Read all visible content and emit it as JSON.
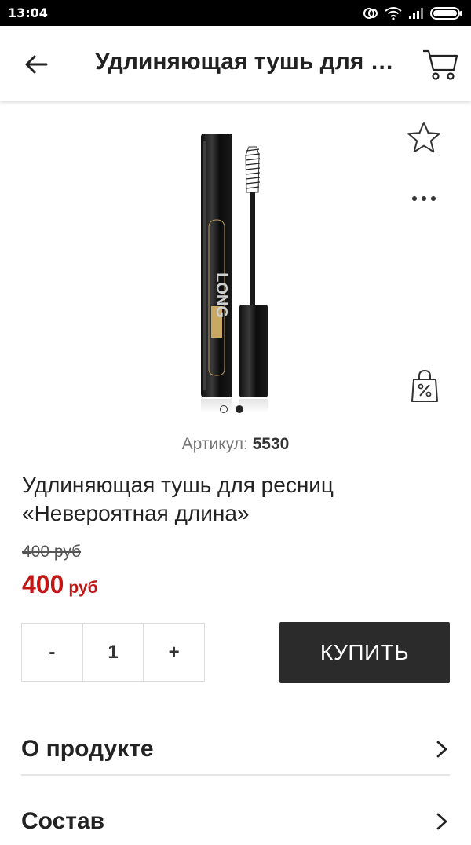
{
  "status_bar": {
    "time": "13:04"
  },
  "header": {
    "title": "Удлиняющая тушь для ресниц «Невероятная длина»"
  },
  "product": {
    "sku_label": "Артикул: ",
    "sku": "5530",
    "name": "Удлиняющая тушь для ресниц «Невероятная длина»",
    "old_price": "400 руб",
    "price": "400",
    "currency": "руб",
    "image_label": "LONG",
    "image_count": 2,
    "active_image": 2
  },
  "purchase": {
    "minus": "-",
    "quantity": "1",
    "plus": "+",
    "buy_label": "КУПИТЬ"
  },
  "sections": [
    {
      "label": "О продукте"
    },
    {
      "label": "Состав"
    }
  ],
  "colors": {
    "price": "#c21616",
    "buy_button": "#2b2b2b"
  },
  "icons": [
    "back-arrow-icon",
    "cart-icon",
    "star-icon",
    "more-icon",
    "discount-bag-icon",
    "chevron-right-icon"
  ]
}
